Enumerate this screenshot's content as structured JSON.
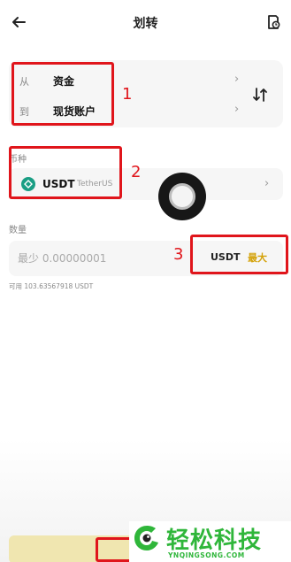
{
  "header": {
    "title": "划转"
  },
  "transfer": {
    "from_label": "从",
    "from_value": "资金",
    "to_label": "到",
    "to_value": "现货账户"
  },
  "coin": {
    "section_label": "币种",
    "symbol": "USDT",
    "name": "TetherUS"
  },
  "amount": {
    "section_label": "数量",
    "placeholder": "最少 0.00000001",
    "unit": "USDT",
    "max_label": "最大",
    "available": "可用 103.63567918 USDT"
  },
  "annotations": {
    "n1": "1",
    "n2": "2",
    "n3": "3"
  },
  "watermark": {
    "text": "轻松科技",
    "sub": "YNQINGSONG.COM"
  },
  "colors": {
    "accent": "#f0b90b",
    "max_text": "#d4a20a",
    "annotation_red": "#e0151b",
    "usdt_green": "#1a9e84",
    "watermark_green": "#2fb63a"
  },
  "icons": {
    "back": "arrow-left-icon",
    "history": "history-icon",
    "swap": "swap-vertical-icon",
    "chevron": "chevron-right-icon"
  }
}
